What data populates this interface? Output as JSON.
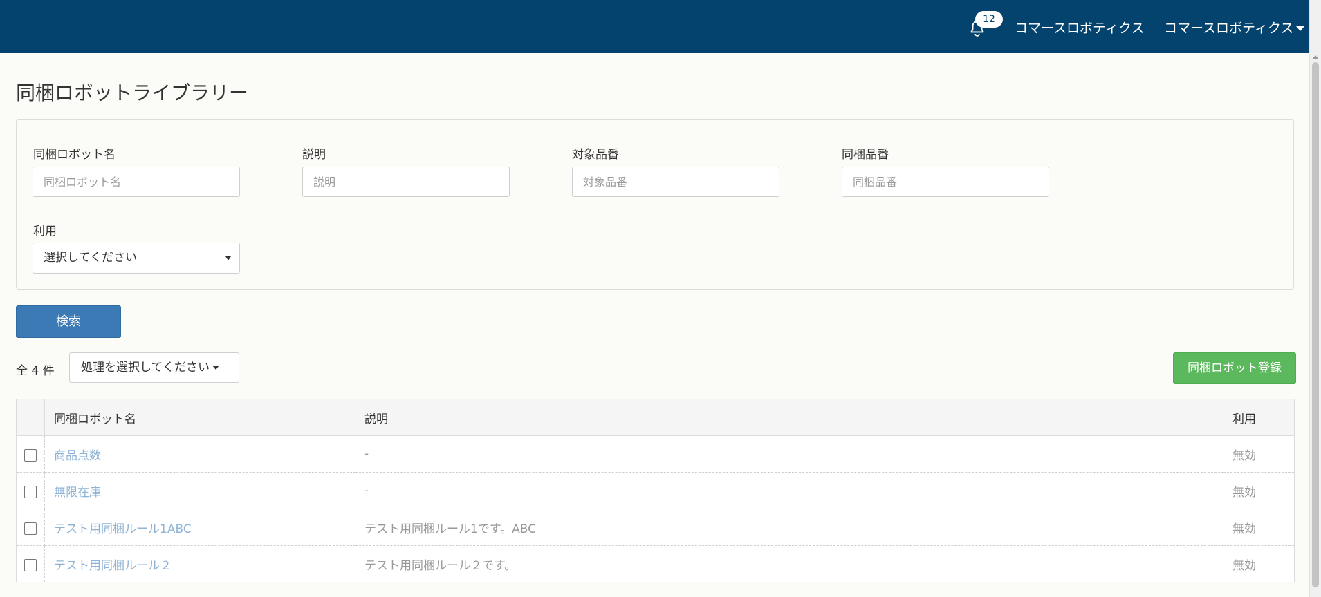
{
  "header": {
    "notification_count": "12",
    "shop_name": "コマースロボティクス",
    "user_menu_label": "コマースロボティクス"
  },
  "page": {
    "title": "同梱ロボットライブラリー"
  },
  "search": {
    "fields": {
      "robot_name": {
        "label": "同梱ロボット名",
        "placeholder": "同梱ロボット名",
        "value": ""
      },
      "description": {
        "label": "説明",
        "placeholder": "説明",
        "value": ""
      },
      "target_sku": {
        "label": "対象品番",
        "placeholder": "対象品番",
        "value": ""
      },
      "bundle_sku": {
        "label": "同梱品番",
        "placeholder": "同梱品番",
        "value": ""
      },
      "usage": {
        "label": "利用",
        "selected": "選択してください"
      }
    },
    "submit_label": "検索"
  },
  "list": {
    "total_label": "全 4 件",
    "action_select_label": "処理を選択してください",
    "register_label": "同梱ロボット登録",
    "columns": [
      "同梱ロボット名",
      "説明",
      "利用"
    ],
    "rows": [
      {
        "name": "商品点数",
        "description": "-",
        "usage": "無効"
      },
      {
        "name": "無限在庫",
        "description": "-",
        "usage": "無効"
      },
      {
        "name": "テスト用同梱ルール1ABC",
        "description": "テスト用同梱ルール1です。ABC",
        "usage": "無効"
      },
      {
        "name": "テスト用同梱ルール２",
        "description": "テスト用同梱ルール２です。",
        "usage": "無効"
      }
    ]
  },
  "colors": {
    "header_bg": "#04436d",
    "search_button": "#3c7ab5",
    "register_button": "#5cb85c",
    "link": "#8fb3d5"
  }
}
